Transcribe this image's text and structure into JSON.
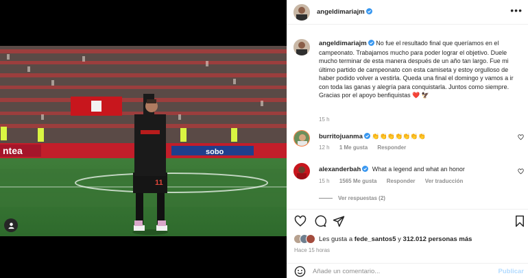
{
  "post": {
    "author": "angeldimariajm",
    "caption": "No fue el resultado final que queríamos en el campeonato. Trabajamos mucho para poder lograr el objetivo. Duele mucho terminar de esta manera después de un año tan largo. Fue mi último partido de campeonato con esta camiseta y estoy orgulloso de haber podido volver a vestirla. Queda una final el domingo y vamos a ir con toda las ganas y alegría para conquistarla. Juntos como siempre. Gracias por el apoyo benfiquistas",
    "caption_emoji": "❤️ 🦅",
    "caption_time": "15 h",
    "player_number": "11"
  },
  "comments": [
    {
      "user": "burritojuanma",
      "text": "👏👏👏👏👏👏👏",
      "time": "12 h",
      "likes": "1 Me gusta",
      "reply": "Responder"
    },
    {
      "user": "alexanderbah",
      "text": "What a legend and what an honor",
      "time": "15 h",
      "likes": "1565 Me gusta",
      "reply": "Responder",
      "translate": "Ver traducción"
    }
  ],
  "view_replies": "Ver respuestas (2)",
  "likes": {
    "prefix": "Les gusta a",
    "user": "fede_santos5",
    "middle": "y",
    "count": "312.012 personas más"
  },
  "time_ago": "Hace 15 horas",
  "add_comment": {
    "placeholder": "Añade un comentario...",
    "publish": "Publicar"
  },
  "colors": {
    "verified": "#3897f0",
    "benfica_red": "#d2102a",
    "publish_disabled": "#b3dbff"
  },
  "icons": [
    "heart-icon",
    "comment-icon",
    "share-icon",
    "save-icon",
    "emoji-icon",
    "more-icon",
    "verified-icon",
    "tag-icon"
  ]
}
